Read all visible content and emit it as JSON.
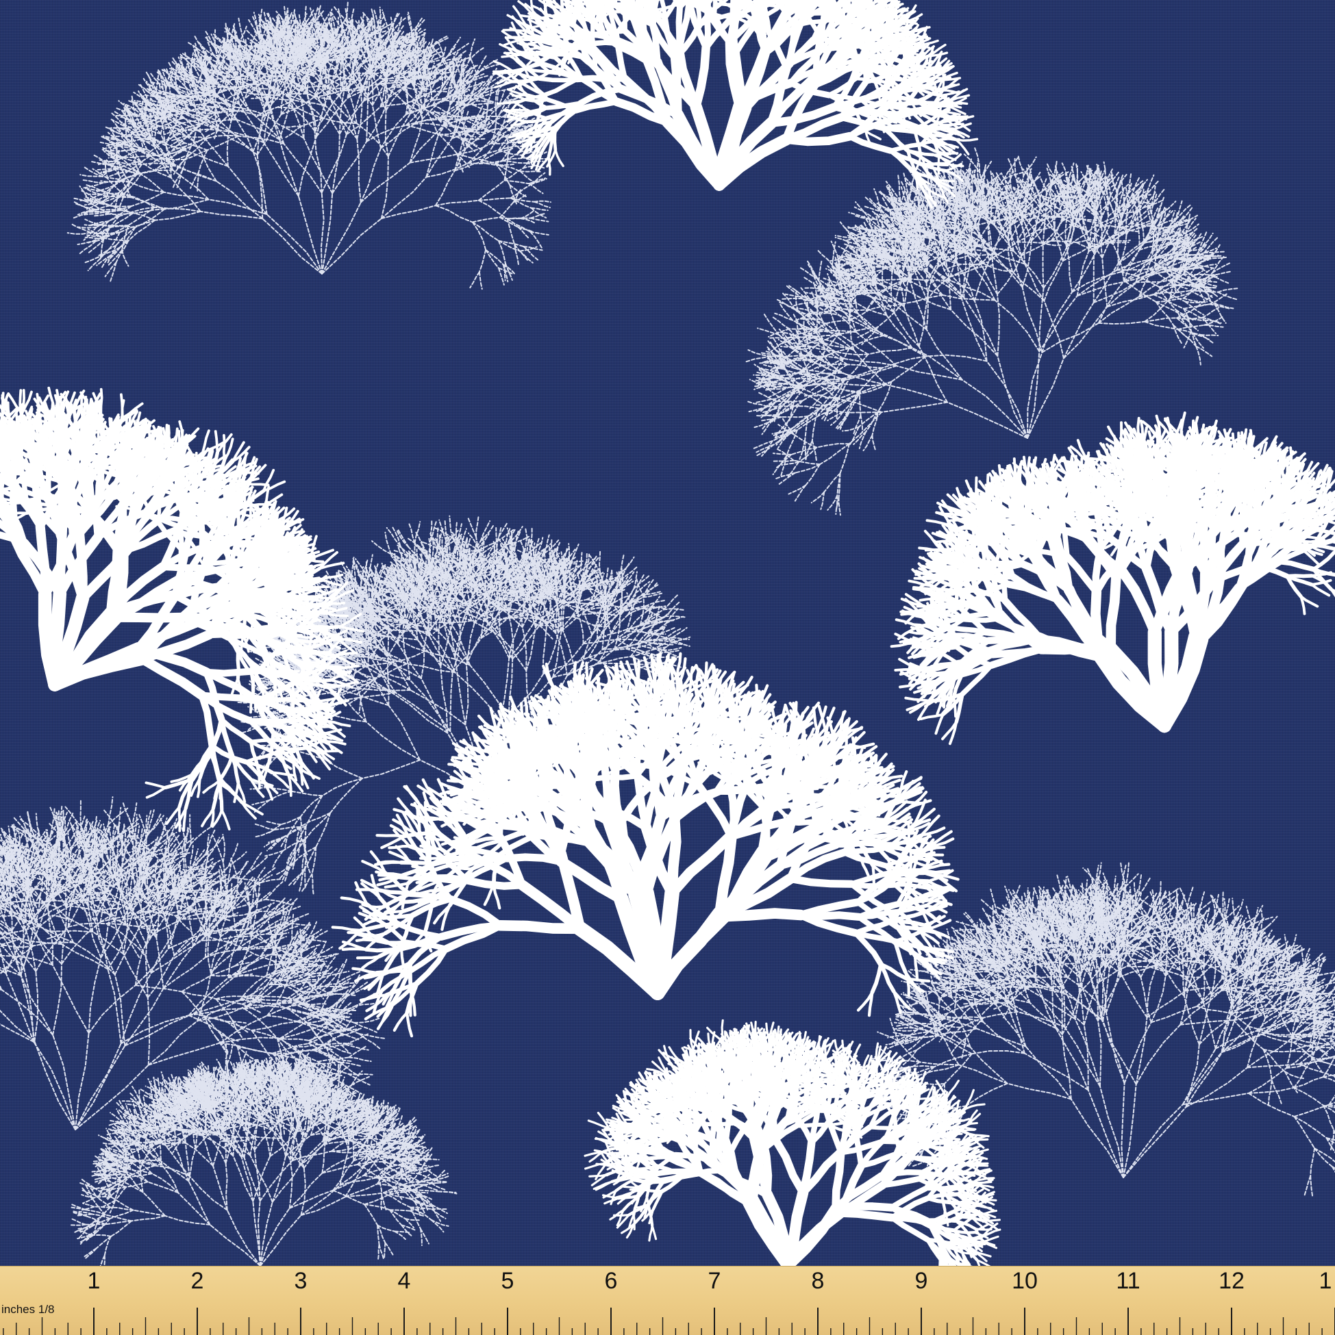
{
  "colors": {
    "background": "#243469",
    "coral_solid": "#ffffff",
    "coral_stitched": "#dfe3f0",
    "ruler": "#efd08c"
  },
  "pattern": {
    "solid_corals": 5,
    "stitched_outline_corals": 6
  },
  "ruler": {
    "unit_label": "inches 1/8",
    "numbers": [
      "1",
      "2",
      "3",
      "4",
      "5",
      "6",
      "7",
      "8",
      "9",
      "10",
      "11",
      "12",
      "1"
    ]
  }
}
